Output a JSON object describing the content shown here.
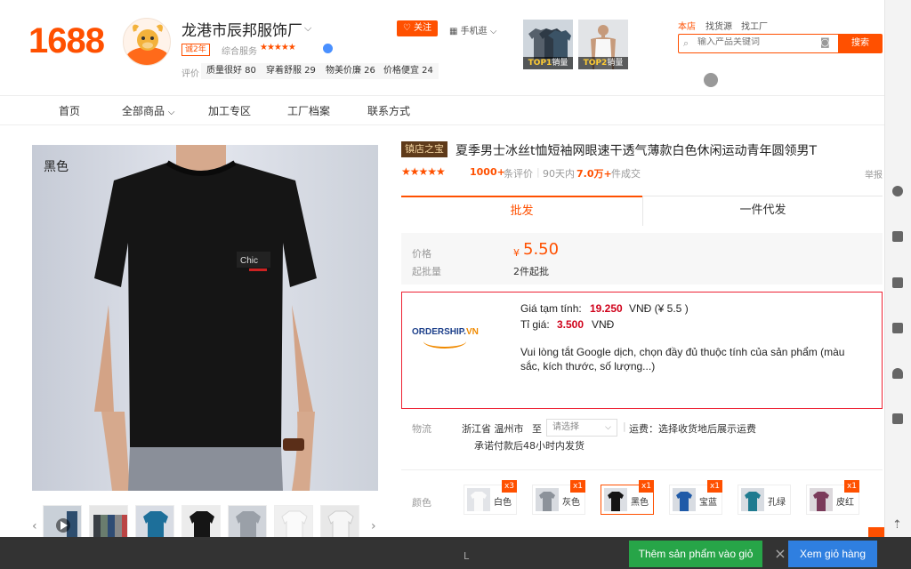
{
  "header": {
    "logo": "1688",
    "shop_name": "龙港市辰邦服饰厂",
    "years_badge": "诚2年",
    "service_label": "综合服务",
    "service_stars": "★★★★★",
    "rating_label": "评价",
    "ratings": [
      "质量很好 80",
      "穿着舒服 29",
      "物美价廉 26",
      "价格便宜 24"
    ],
    "follow_label": "关注",
    "mobile_label": "手机逛",
    "top_items": [
      {
        "rank": "TOP1",
        "suffix": "销量"
      },
      {
        "rank": "TOP2",
        "suffix": "销量"
      }
    ],
    "search_scopes": [
      "本店",
      "找货源",
      "找工厂"
    ],
    "search_placeholder": "输入产品关键词",
    "search_button": "搜索"
  },
  "nav": {
    "items": [
      "首页",
      "全部商品",
      "加工专区",
      "工厂档案",
      "联系方式"
    ]
  },
  "gallery": {
    "color_caption": "黑色"
  },
  "product": {
    "store_badge": "镇店之宝",
    "title": "夏季男士冰丝t恤短袖网眼速干透气薄款白色休闲运动青年圆领男T",
    "stars": "★★★★★",
    "reviews_count": "1000+",
    "reviews_label": "条评价",
    "days_label": "90天内",
    "days_value": "7.0万+",
    "days_suffix": "件成交",
    "report": "举报"
  },
  "tabs": {
    "wholesale": "批发",
    "dropship": "一件代发"
  },
  "price": {
    "label": "价格",
    "currency": "¥",
    "value": "5.50",
    "moq_label": "起批量",
    "moq_value": "2件起批"
  },
  "ordership": {
    "logo_main": "ORDERSHIP.",
    "logo_suffix": "VN",
    "est_label": "Giá tạm tính:",
    "est_value": "19.250",
    "est_suffix": "VNĐ (¥ 5.5 )",
    "rate_label": "Tỉ giá:",
    "rate_value": "3.500",
    "rate_suffix": "VNĐ",
    "note": "Vui lòng tắt Google dịch, chọn đầy đủ thuộc tính của sản phẩm (màu sắc, kích thước, số lượng...)"
  },
  "logistics": {
    "label": "物流",
    "origin": "浙江省  温州市",
    "to": "至",
    "select_placeholder": "请选择",
    "fee": "运费：选择收货地后展示运费",
    "promise": "承诺付款后48小时内发货"
  },
  "colors": {
    "label": "颜色",
    "options": [
      {
        "name": "白色",
        "badge": "x3"
      },
      {
        "name": "灰色",
        "badge": "x1"
      },
      {
        "name": "黑色",
        "badge": "x1"
      },
      {
        "name": "宝蓝",
        "badge": "x1"
      },
      {
        "name": "孔绿",
        "badge": ""
      },
      {
        "name": "皮红",
        "badge": "x1"
      }
    ]
  },
  "bottom": {
    "size_value": "L",
    "add_button": "Thêm sản phẩm vào giỏ",
    "cart_button": "Xem giỏ hàng",
    "remove_icon": "×"
  },
  "colors_theme": {
    "accent": "#ff5000",
    "green": "#27a548",
    "blue": "#2f7fe0"
  }
}
